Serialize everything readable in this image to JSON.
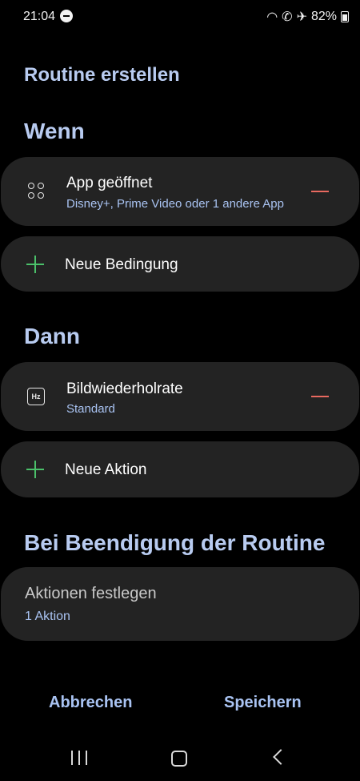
{
  "status": {
    "time": "21:04",
    "battery": "82%",
    "icons": [
      "wifi-icon",
      "wifi-calling-icon",
      "airplane-icon",
      "battery-icon"
    ]
  },
  "page": {
    "title": "Routine erstellen"
  },
  "wenn": {
    "heading": "Wenn",
    "condition": {
      "title": "App geöffnet",
      "subtitle": "Disney+, Prime Video oder 1 andere App"
    },
    "add_label": "Neue Bedingung"
  },
  "dann": {
    "heading": "Dann",
    "action": {
      "title": "Bildwiederholrate",
      "subtitle": "Standard",
      "icon_text": "Hz"
    },
    "add_label": "Neue Aktion"
  },
  "end": {
    "heading": "Bei Beendigung der Routine",
    "title": "Aktionen festlegen",
    "subtitle": "1 Aktion"
  },
  "buttons": {
    "cancel": "Abbrechen",
    "save": "Speichern"
  },
  "colors": {
    "accent": "#a9c3f2",
    "remove": "#e8695f",
    "add": "#4bc06a",
    "card": "#232323"
  }
}
